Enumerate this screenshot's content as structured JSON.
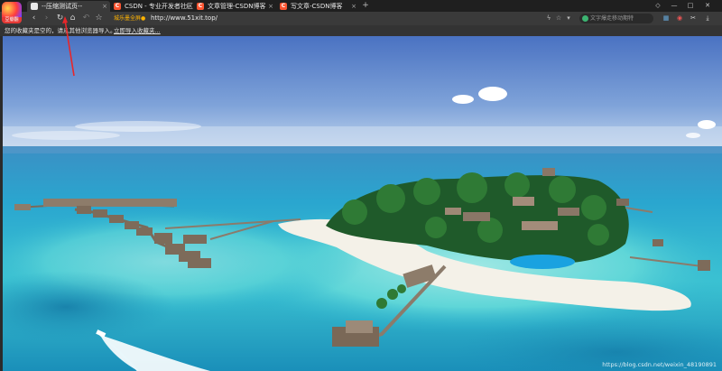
{
  "browser": {
    "logo_label": "豆瓣翻",
    "tabs": [
      {
        "title": "--压缩测试页--",
        "favicon": "document-icon",
        "active": true
      },
      {
        "title": "CSDN - 专业开发者社区",
        "favicon": "csdn-icon",
        "active": false
      },
      {
        "title": "文章管理-CSDN博客",
        "favicon": "csdn-icon",
        "active": false
      },
      {
        "title": "写文章-CSDN博客",
        "favicon": "csdn-icon",
        "active": false
      }
    ],
    "close_glyph": "×",
    "new_tab_glyph": "+"
  },
  "toolbar": {
    "security_flag": "城乐墨全屏●",
    "url": "http://www.51xit.top/",
    "search_placeholder": "文字爆走移动期特"
  },
  "bookmarks_bar": {
    "empty_text": "您的收藏夹是空的，请从其他浏览器导入。",
    "import_link": "立即导入收藏夹..."
  },
  "content": {
    "watermark": "https://blog.csdn.net/weixin_48190891"
  },
  "colors": {
    "sky_top": "#4a76c4",
    "sky_horizon": "#c5d8ef",
    "sea_deep": "#1c85b8",
    "lagoon": "#4fd0d6",
    "sand": "#f4f1e8",
    "annotation_arrow": "#e8262a"
  }
}
